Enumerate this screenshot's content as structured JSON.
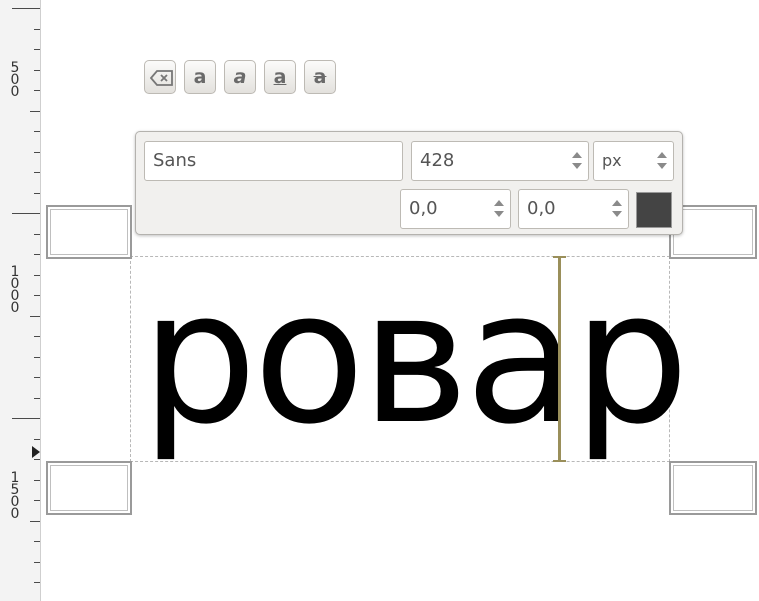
{
  "canvas": {
    "layer_text": "ровар"
  },
  "ruler": {
    "labels": [
      {
        "digits": [
          "5",
          "0",
          "0"
        ]
      },
      {
        "digits": [
          "1",
          "0",
          "0",
          "0"
        ]
      },
      {
        "digits": [
          "1",
          "5",
          "0",
          "0"
        ]
      }
    ]
  },
  "text_toolbar": {
    "font_family": "Sans",
    "font_size": "428",
    "unit": "px",
    "baseline_offset": "0,0",
    "kerning_offset": "0,0",
    "text_color": "#444444",
    "style_buttons": [
      {
        "icon": "clear-style-icon"
      },
      {
        "glyph": "a",
        "style": "bold"
      },
      {
        "glyph": "a",
        "style": "italic"
      },
      {
        "glyph": "a",
        "style": "underline"
      },
      {
        "glyph": "a",
        "style": "strikethrough"
      }
    ]
  }
}
